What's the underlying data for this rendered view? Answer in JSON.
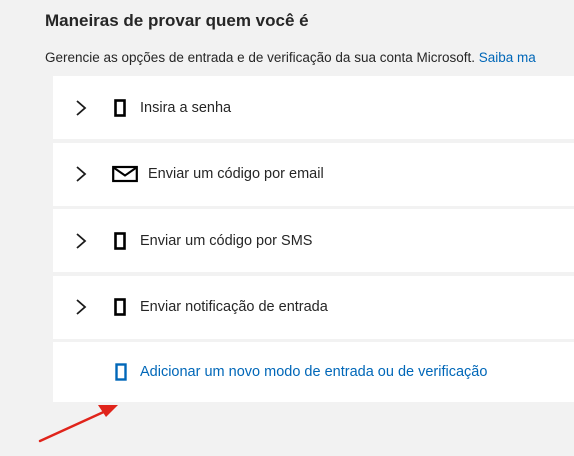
{
  "section": {
    "title": "Maneiras de provar quem você é",
    "description": "Gerencie as opções de entrada e de verificação da sua conta Microsoft.",
    "learn_more_link": "Saiba ma"
  },
  "methods": [
    {
      "label": "Insira a senha",
      "icon": "phone-icon"
    },
    {
      "label": "Enviar um código por email",
      "icon": "mail-icon"
    },
    {
      "label": "Enviar um código por SMS",
      "icon": "phone-icon"
    },
    {
      "label": "Enviar notificação de entrada",
      "icon": "phone-icon"
    }
  ],
  "add_method": {
    "label": "Adicionar um novo modo de entrada ou de verificação",
    "icon": "phone-icon"
  },
  "colors": {
    "accent": "#0067b8",
    "annotation_arrow": "#e0241b",
    "background": "#f2f2f2",
    "card": "#ffffff"
  }
}
